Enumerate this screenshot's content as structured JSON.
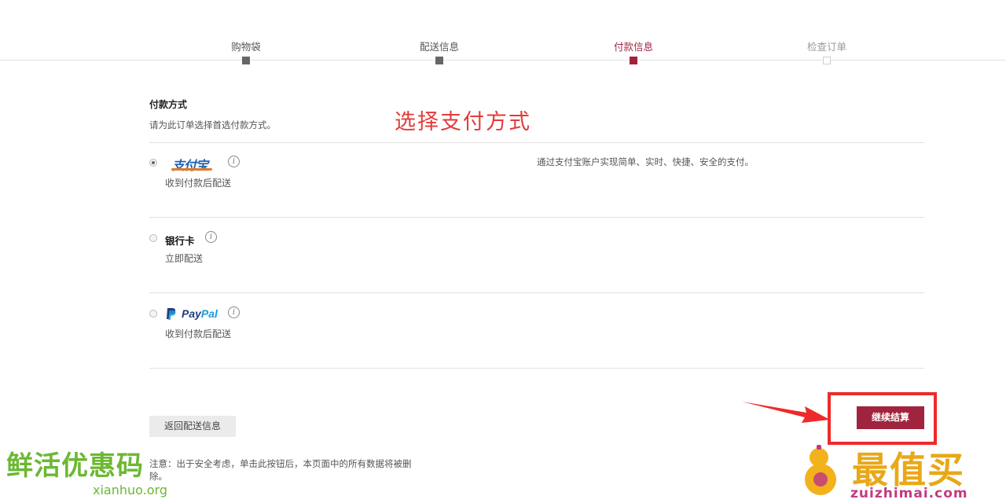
{
  "steps": [
    {
      "label": "购物袋",
      "state": "done"
    },
    {
      "label": "配送信息",
      "state": "done"
    },
    {
      "label": "付款信息",
      "state": "active"
    },
    {
      "label": "检查订单",
      "state": "todo"
    }
  ],
  "payment": {
    "title": "付款方式",
    "subtitle": "请为此订单选择首选付款方式。",
    "annotation": "选择支付方式",
    "methods": [
      {
        "logo_text": "支付宝",
        "shipping": "收到付款后配送",
        "description": "通过支付宝账户实现简单、实时、快捷、安全的支付。",
        "selected": true,
        "icon": "alipay-logo"
      },
      {
        "name": "银行卡",
        "shipping": "立即配送",
        "selected": false
      },
      {
        "logo_text_1": "Pay",
        "logo_text_2": "Pal",
        "shipping": "收到付款后配送",
        "selected": false,
        "icon": "paypal-logo"
      }
    ],
    "info_glyph": "i"
  },
  "actions": {
    "back_label": "返回配送信息",
    "continue_label": "继续结算",
    "note": "注意：出于安全考虑，单击此按钮后，本页面中的所有数据将被删除。"
  },
  "watermarks": {
    "left_cn": "鲜活优惠码",
    "left_en": "xianhuo.org",
    "right_cn": "最值买",
    "right_en": "zuizhimai.com"
  },
  "colors": {
    "accent": "#a0243e",
    "annotation": "#e53a3a"
  }
}
